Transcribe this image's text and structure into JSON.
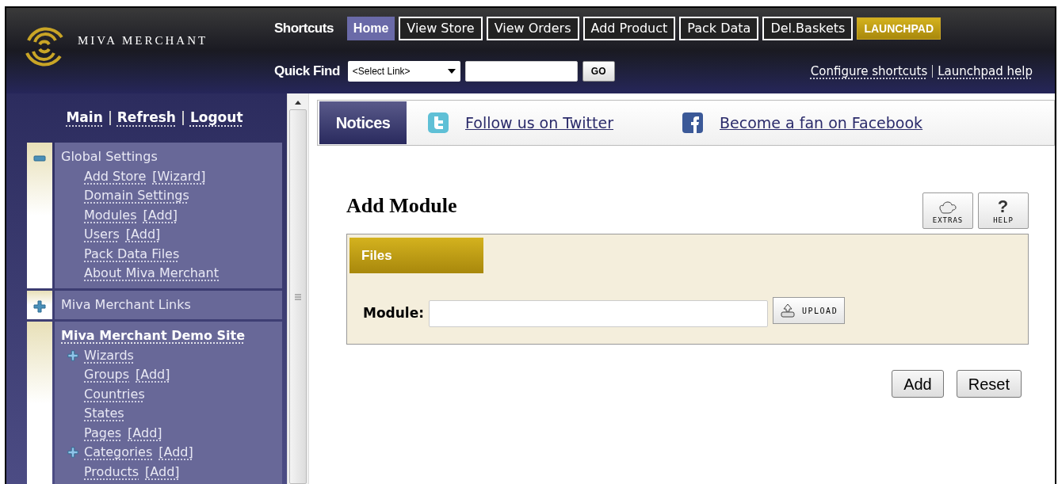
{
  "brand": {
    "name": "MIVA MERCHANT"
  },
  "shortcuts": {
    "label": "Shortcuts",
    "items": [
      {
        "label": "Home",
        "kind": "tab",
        "selected": true
      },
      {
        "label": "View Store",
        "kind": "tab",
        "selected": false
      },
      {
        "label": "View Orders",
        "kind": "tab",
        "selected": false
      },
      {
        "label": "Add Product",
        "kind": "tab",
        "selected": false
      },
      {
        "label": "Pack Data",
        "kind": "tab",
        "selected": false
      },
      {
        "label": "Del.Baskets",
        "kind": "tab",
        "selected": false
      },
      {
        "label": "LAUNCHPAD",
        "kind": "launchpad",
        "selected": false
      }
    ]
  },
  "quick_find": {
    "label": "Quick Find",
    "select": "<Select Link>",
    "button": "GO"
  },
  "header_links": [
    "Configure shortcuts",
    "Launchpad help"
  ],
  "sidebar": {
    "links": [
      "Main",
      "Refresh",
      "Logout"
    ],
    "groups": [
      {
        "title": "Global Settings",
        "kind": "section",
        "expanded": true,
        "items": [
          {
            "label": "Add Store",
            "extra": "[Wizard]"
          },
          {
            "label": "Domain Settings"
          },
          {
            "label": "Modules",
            "extra": "[Add]"
          },
          {
            "label": "Users",
            "extra": "[Add]"
          },
          {
            "label": "Pack Data Files"
          },
          {
            "label": "About Miva Merchant"
          }
        ]
      },
      {
        "title": "Miva Merchant Links",
        "kind": "section",
        "expanded": false
      },
      {
        "title": "Miva Merchant Demo Site",
        "kind": "site",
        "items": [
          {
            "label": "Wizards",
            "expanded": false
          },
          {
            "label": "Groups",
            "extra": "[Add]"
          },
          {
            "label": "Countries"
          },
          {
            "label": "States"
          },
          {
            "label": "Pages",
            "extra": "[Add]"
          },
          {
            "label": "Categories",
            "extra": "[Add]",
            "expanded": false
          },
          {
            "label": "Products",
            "extra": "[Add]"
          }
        ]
      }
    ]
  },
  "notices": {
    "label": "Notices",
    "links": [
      {
        "label": "Follow us on Twitter",
        "kind": "twitter"
      },
      {
        "label": "Become a fan on Facebook",
        "kind": "facebook"
      }
    ]
  },
  "page": {
    "title": "Add Module",
    "tools": [
      {
        "label": "EXTRAS",
        "kind": "extras"
      },
      {
        "label": "HELP",
        "kind": "help",
        "glyph": "?"
      }
    ],
    "panel": {
      "tab": "Files",
      "field": {
        "label": "Module:"
      },
      "upload": "UPLOAD"
    },
    "buttons": [
      "Add",
      "Reset"
    ]
  }
}
